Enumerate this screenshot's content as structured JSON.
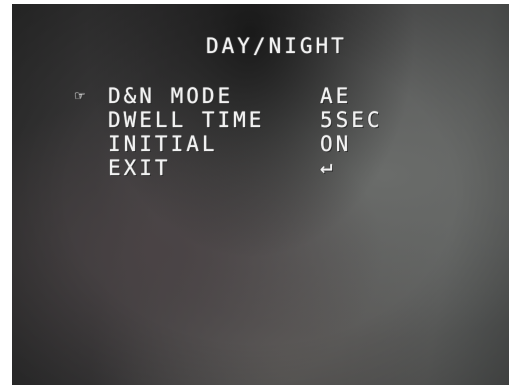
{
  "osd_menu": {
    "title": "DAY/NIGHT",
    "cursor_icon": "hand-pointer-icon",
    "cursor_glyph": "☞",
    "items": [
      {
        "label": "D&N MODE",
        "value": "AE"
      },
      {
        "label": "DWELL TIME",
        "value": "5SEC"
      },
      {
        "label": "INITIAL",
        "value": "ON"
      },
      {
        "label": "EXIT",
        "value": "↵",
        "value_icon": "enter-return-icon"
      }
    ],
    "colors": {
      "text": "#f2f2f2",
      "background_dark": "#2f2f2f",
      "background_light": "#5e605f"
    }
  }
}
